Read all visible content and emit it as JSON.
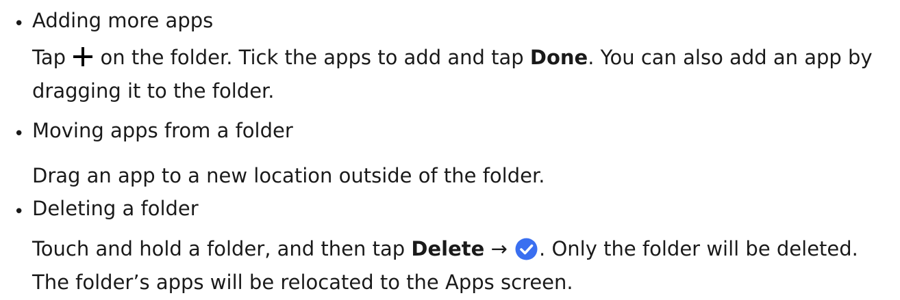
{
  "sections": [
    {
      "title": "Adding more apps",
      "body_line1_before_icon": "Tap",
      "body_line1_after_icon": " on the folder. Tick the apps to add and tap ",
      "body_line1_bold": "Done",
      "body_line1_tail": ". You can also add an app by",
      "body_line2": "dragging it to the folder.",
      "icon": "plus-icon"
    },
    {
      "title": "Moving apps from a folder",
      "body_line1": "Drag an app to a new location outside of the folder."
    },
    {
      "title": "Deleting a folder",
      "body_line1_before_bold": "Touch and hold a folder, and then tap ",
      "body_line1_bold": "Delete",
      "body_line1_arrow": " → ",
      "body_line1_after_icon": ". Only the folder will be deleted.",
      "body_line2": "The folder’s apps will be relocated to the Apps screen.",
      "icon": "check-circle-icon",
      "icon_color": "#3a6ff0"
    }
  ],
  "bullet_char": "•"
}
